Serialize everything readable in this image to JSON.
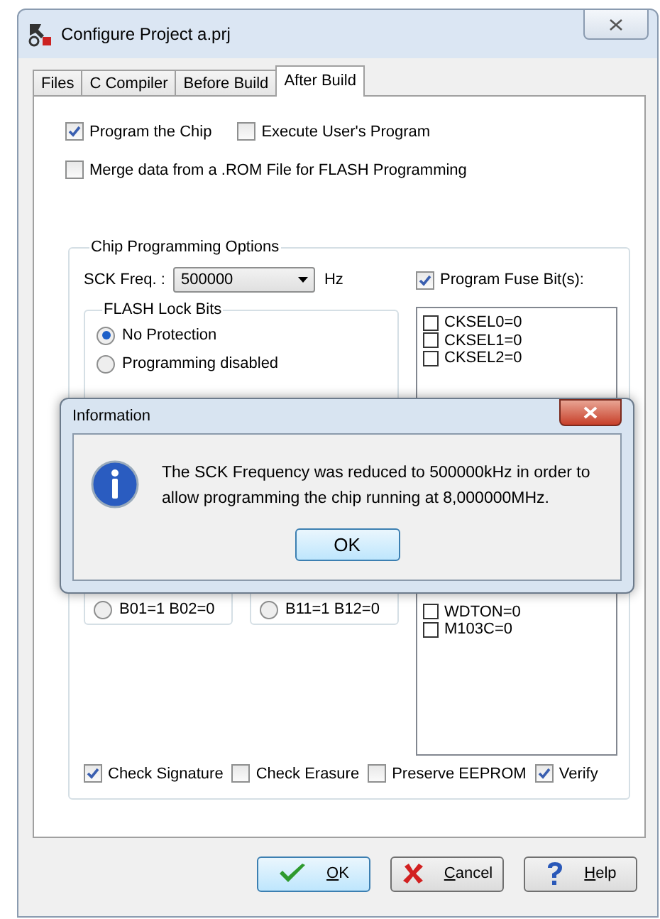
{
  "window": {
    "title": "Configure Project a.prj"
  },
  "tabs": [
    {
      "label": "Files",
      "selected": false
    },
    {
      "label": "C Compiler",
      "selected": false
    },
    {
      "label": "Before Build",
      "selected": false
    },
    {
      "label": "After Build",
      "selected": true
    }
  ],
  "top_options": [
    {
      "label": "Program the Chip",
      "checked": true
    },
    {
      "label": "Execute User's Program",
      "checked": false
    },
    {
      "label": "Merge data from a .ROM File for FLASH Programming",
      "checked": false
    }
  ],
  "chip_programming": {
    "title": "Chip Programming Options",
    "sck_label": "SCK Freq. :",
    "sck_value": "500000",
    "sck_unit": "Hz",
    "program_fuse": {
      "label": "Program Fuse Bit(s):",
      "checked": true
    },
    "flash_lock": {
      "title": "FLASH Lock Bits",
      "options": [
        {
          "label": "No Protection",
          "selected": true
        },
        {
          "label": "Programming disabled",
          "selected": false
        }
      ]
    },
    "boot_lock_options": [
      {
        "label": "B01=1 B02=0",
        "selected": false
      },
      {
        "label": "B11=1 B12=0",
        "selected": false
      }
    ],
    "fuse_bits_top": [
      {
        "label": "CKSEL0=0",
        "checked": false
      },
      {
        "label": "CKSEL1=0",
        "checked": false
      },
      {
        "label": "CKSEL2=0",
        "checked": false
      }
    ],
    "fuse_bits_bottom": [
      {
        "label": "WDTON=0",
        "checked": false
      },
      {
        "label": "M103C=0",
        "checked": false
      }
    ],
    "bottom_options": [
      {
        "label": "Check Signature",
        "checked": true
      },
      {
        "label": "Check Erasure",
        "checked": false
      },
      {
        "label": "Preserve EEPROM",
        "checked": false
      },
      {
        "label": "Verify",
        "checked": true
      }
    ]
  },
  "buttons": [
    {
      "kind": "ok",
      "label": "OK"
    },
    {
      "kind": "cancel",
      "label": "Cancel"
    },
    {
      "kind": "help",
      "label": "Help"
    }
  ],
  "message_box": {
    "title": "Information",
    "message": "The SCK Frequency was reduced to 500000kHz in order to allow programming the chip running at 8,000000MHz.",
    "button": "OK"
  }
}
